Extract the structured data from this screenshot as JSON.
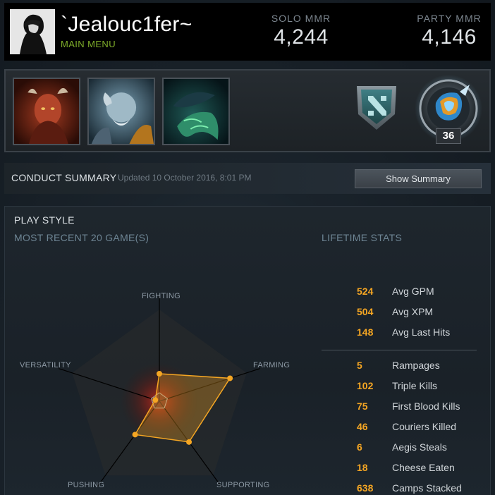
{
  "profile": {
    "username": "`Jealouc1fer~",
    "subtitle": "MAIN MENU",
    "solo_mmr_label": "SOLO MMR",
    "solo_mmr_value": "4,244",
    "party_mmr_label": "PARTY MMR",
    "party_mmr_value": "4,146"
  },
  "heroes": [
    {
      "icon": "hero-portrait-red-horned"
    },
    {
      "icon": "hero-portrait-blue-beast"
    },
    {
      "icon": "hero-portrait-dark-green"
    }
  ],
  "rank": {
    "badge_number": "36",
    "shield_icon": "dota-shield-icon",
    "medal_icon": "rank-medal-icon"
  },
  "conduct": {
    "title": "CONDUCT SUMMARY",
    "updated": "Updated 10 October 2016, 8:01 PM",
    "button_label": "Show Summary"
  },
  "playstyle": {
    "title": "PLAY STYLE",
    "recent_label": "MOST RECENT 20 GAME(S)",
    "lifetime_label": "LIFETIME STATS",
    "axes": {
      "fighting": "FIGHTING",
      "farming": "FARMING",
      "supporting": "SUPPORTING",
      "pushing": "PUSHING",
      "versatility": "VERSATILITY"
    },
    "values": {
      "fighting": 0.3,
      "farming": 0.81,
      "supporting": 0.55,
      "pushing": 0.45,
      "versatility": 0.02
    },
    "accent_color": "#f5a623"
  },
  "stats_top": [
    {
      "value": "524",
      "label": "Avg GPM"
    },
    {
      "value": "504",
      "label": "Avg XPM"
    },
    {
      "value": "148",
      "label": "Avg Last Hits"
    }
  ],
  "stats_bottom": [
    {
      "value": "5",
      "label": "Rampages"
    },
    {
      "value": "102",
      "label": "Triple Kills"
    },
    {
      "value": "75",
      "label": "First Blood Kills"
    },
    {
      "value": "46",
      "label": "Couriers Killed"
    },
    {
      "value": "6",
      "label": "Aegis Steals"
    },
    {
      "value": "18",
      "label": "Cheese Eaten"
    },
    {
      "value": "638",
      "label": "Camps Stacked"
    }
  ]
}
